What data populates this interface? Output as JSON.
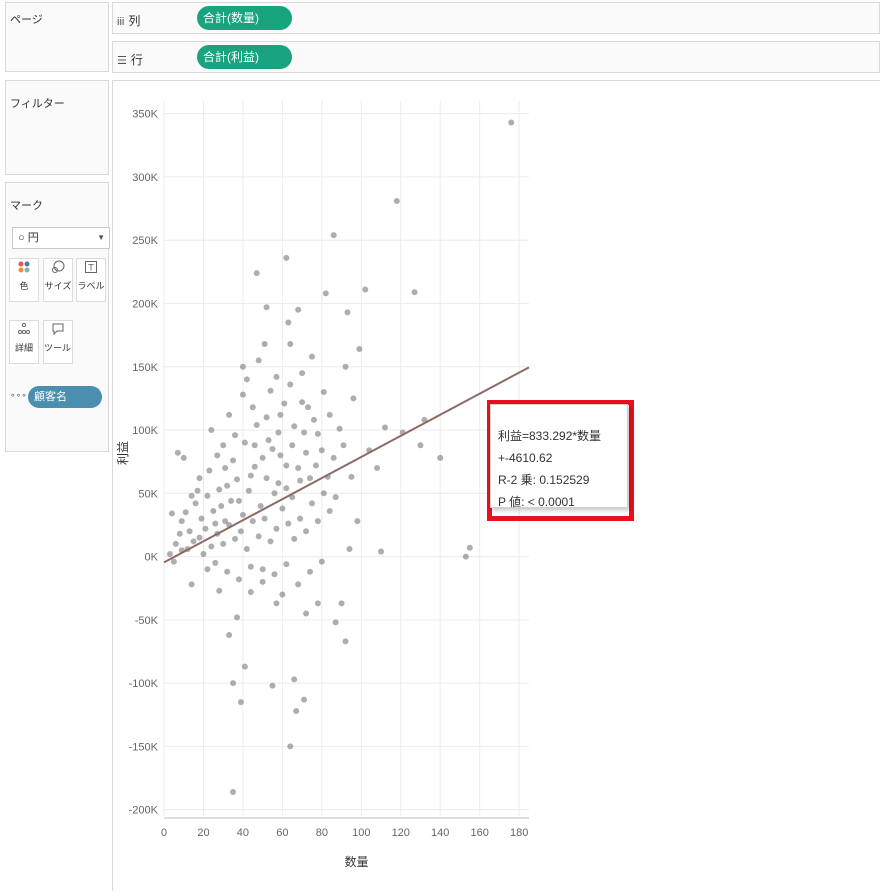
{
  "shelves": {
    "pages_label": "ページ",
    "filters_label": "フィルター",
    "columns": {
      "icon": "iii",
      "label": "列",
      "pill": "合計(数量)"
    },
    "rows": {
      "icon": "☰",
      "label": "行",
      "pill": "合計(利益)"
    }
  },
  "marks": {
    "title": "マーク",
    "type_select": "○ 円",
    "buttons": [
      {
        "icon": "color-icon",
        "label": "色"
      },
      {
        "icon": "size-icon",
        "label": "サイズ"
      },
      {
        "icon": "label-icon",
        "label": "ラベル"
      },
      {
        "icon": "detail-icon",
        "label": "詳細"
      },
      {
        "icon": "tooltip-icon",
        "label": "ツールヒ..."
      }
    ],
    "detail_pill": "顧客名"
  },
  "tooltip": {
    "line1": "利益=833.292*数量+-4610.62",
    "line2": "R-2 乗: 0.152529",
    "line3": "P 値: < 0.0001"
  },
  "colors": {
    "green_pill": "#1aa37f",
    "blue_pill": "#4a8fb0",
    "trend_line": "#8c6a66",
    "points": "#6b6b6b",
    "highlight": "#e8101e"
  },
  "chart_data": {
    "type": "scatter",
    "xlabel": "数量",
    "ylabel": "利益",
    "xlim": [
      0,
      185
    ],
    "ylim": [
      -205000,
      360000
    ],
    "x_ticks": [
      0,
      20,
      40,
      60,
      80,
      100,
      120,
      140,
      160,
      180
    ],
    "y_ticks": [
      -200000,
      -150000,
      -100000,
      -50000,
      0,
      50000,
      100000,
      150000,
      200000,
      250000,
      300000,
      350000
    ],
    "y_tick_labels": [
      "-200K",
      "-150K",
      "-100K",
      "-50K",
      "0K",
      "50K",
      "100K",
      "150K",
      "200K",
      "250K",
      "300K",
      "350K"
    ],
    "grid": true,
    "trend": {
      "slope": 833.292,
      "intercept": -4610.62
    },
    "points": [
      [
        176,
        343000
      ],
      [
        118,
        281000
      ],
      [
        86,
        254000
      ],
      [
        127,
        209000
      ],
      [
        102,
        211000
      ],
      [
        62,
        236000
      ],
      [
        47,
        224000
      ],
      [
        153,
        0
      ],
      [
        155,
        7000
      ],
      [
        140,
        78000
      ],
      [
        132,
        108000
      ],
      [
        130,
        88000
      ],
      [
        112,
        102000
      ],
      [
        121,
        98000
      ],
      [
        108,
        70000
      ],
      [
        104,
        84000
      ],
      [
        96,
        125000
      ],
      [
        92,
        150000
      ],
      [
        99,
        164000
      ],
      [
        93,
        193000
      ],
      [
        82,
        208000
      ],
      [
        68,
        195000
      ],
      [
        52,
        197000
      ],
      [
        63,
        185000
      ],
      [
        35,
        -186000
      ],
      [
        64,
        -150000
      ],
      [
        39,
        -115000
      ],
      [
        67,
        -122000
      ],
      [
        55,
        -102000
      ],
      [
        71,
        -113000
      ],
      [
        92,
        -67000
      ],
      [
        87,
        -52000
      ],
      [
        90,
        -37000
      ],
      [
        78,
        -37000
      ],
      [
        110,
        4000
      ],
      [
        94,
        6000
      ],
      [
        98,
        28000
      ],
      [
        87,
        47000
      ],
      [
        83,
        63000
      ],
      [
        66,
        -97000
      ],
      [
        41,
        -87000
      ],
      [
        35,
        -100000
      ],
      [
        33,
        -62000
      ],
      [
        37,
        -48000
      ],
      [
        44,
        -28000
      ],
      [
        57,
        -37000
      ],
      [
        72,
        -45000
      ],
      [
        60,
        -30000
      ],
      [
        50,
        -10000
      ],
      [
        28,
        -27000
      ],
      [
        22,
        -10000
      ],
      [
        14,
        -22000
      ],
      [
        9,
        5000
      ],
      [
        4,
        34000
      ],
      [
        7,
        82000
      ],
      [
        10,
        78000
      ],
      [
        18,
        62000
      ],
      [
        24,
        100000
      ],
      [
        27,
        80000
      ],
      [
        31,
        70000
      ],
      [
        33,
        112000
      ],
      [
        36,
        96000
      ],
      [
        40,
        128000
      ],
      [
        42,
        140000
      ],
      [
        45,
        118000
      ],
      [
        48,
        155000
      ],
      [
        51,
        168000
      ],
      [
        54,
        131000
      ],
      [
        57,
        142000
      ],
      [
        59,
        112000
      ],
      [
        61,
        121000
      ],
      [
        64,
        168000
      ],
      [
        66,
        103000
      ],
      [
        70,
        145000
      ],
      [
        73,
        118000
      ],
      [
        75,
        158000
      ],
      [
        78,
        97000
      ],
      [
        81,
        130000
      ],
      [
        84,
        112000
      ],
      [
        86,
        78000
      ],
      [
        89,
        101000
      ],
      [
        91,
        88000
      ],
      [
        95,
        63000
      ],
      [
        72,
        82000
      ],
      [
        69,
        60000
      ],
      [
        65,
        47000
      ],
      [
        62,
        72000
      ],
      [
        58,
        58000
      ],
      [
        55,
        85000
      ],
      [
        52,
        62000
      ],
      [
        49,
        40000
      ],
      [
        46,
        71000
      ],
      [
        43,
        52000
      ],
      [
        40,
        33000
      ],
      [
        37,
        61000
      ],
      [
        34,
        44000
      ],
      [
        31,
        28000
      ],
      [
        28,
        53000
      ],
      [
        25,
        36000
      ],
      [
        22,
        48000
      ],
      [
        19,
        30000
      ],
      [
        16,
        42000
      ],
      [
        13,
        20000
      ],
      [
        11,
        35000
      ],
      [
        8,
        18000
      ],
      [
        6,
        10000
      ],
      [
        3,
        2000
      ],
      [
        5,
        -4000
      ],
      [
        12,
        6000
      ],
      [
        15,
        12000
      ],
      [
        18,
        15000
      ],
      [
        21,
        22000
      ],
      [
        24,
        8000
      ],
      [
        27,
        18000
      ],
      [
        30,
        10000
      ],
      [
        33,
        25000
      ],
      [
        36,
        14000
      ],
      [
        39,
        20000
      ],
      [
        42,
        6000
      ],
      [
        45,
        28000
      ],
      [
        48,
        16000
      ],
      [
        51,
        30000
      ],
      [
        54,
        12000
      ],
      [
        57,
        22000
      ],
      [
        60,
        38000
      ],
      [
        63,
        26000
      ],
      [
        66,
        14000
      ],
      [
        69,
        30000
      ],
      [
        72,
        20000
      ],
      [
        75,
        42000
      ],
      [
        78,
        28000
      ],
      [
        81,
        50000
      ],
      [
        84,
        36000
      ],
      [
        20,
        2000
      ],
      [
        26,
        -5000
      ],
      [
        32,
        -12000
      ],
      [
        38,
        -18000
      ],
      [
        44,
        -8000
      ],
      [
        50,
        -20000
      ],
      [
        56,
        -14000
      ],
      [
        62,
        -6000
      ],
      [
        68,
        -22000
      ],
      [
        74,
        -12000
      ],
      [
        80,
        -4000
      ],
      [
        17,
        52000
      ],
      [
        23,
        68000
      ],
      [
        29,
        40000
      ],
      [
        35,
        76000
      ],
      [
        41,
        90000
      ],
      [
        47,
        104000
      ],
      [
        53,
        92000
      ],
      [
        59,
        80000
      ],
      [
        65,
        88000
      ],
      [
        71,
        98000
      ],
      [
        77,
        72000
      ],
      [
        9,
        28000
      ],
      [
        14,
        48000
      ],
      [
        26,
        26000
      ],
      [
        32,
        56000
      ],
      [
        38,
        44000
      ],
      [
        44,
        64000
      ],
      [
        50,
        78000
      ],
      [
        56,
        50000
      ],
      [
        62,
        54000
      ],
      [
        68,
        70000
      ],
      [
        74,
        62000
      ],
      [
        80,
        84000
      ],
      [
        30,
        88000
      ],
      [
        46,
        88000
      ],
      [
        58,
        98000
      ],
      [
        64,
        136000
      ],
      [
        70,
        122000
      ],
      [
        40,
        150000
      ],
      [
        52,
        110000
      ],
      [
        76,
        108000
      ]
    ]
  }
}
